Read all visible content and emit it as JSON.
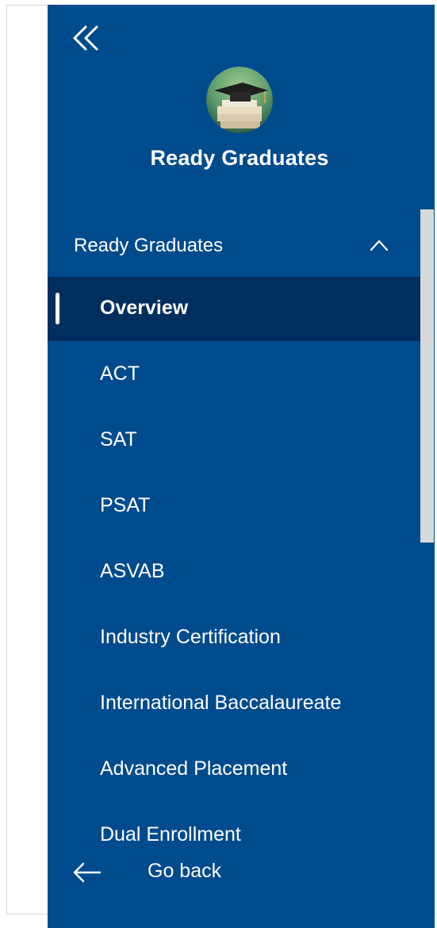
{
  "app": {
    "title": "Ready Graduates"
  },
  "icons": {
    "collapse": "double-chevron-left-icon",
    "section_toggle": "chevron-up-icon",
    "back": "arrow-left-icon"
  },
  "colors": {
    "sidebar_bg": "#004b8d",
    "active_item_bg": "#002e5e",
    "text": "#ffffff",
    "scrollbar": "#d9d9d9"
  },
  "section": {
    "label": "Ready Graduates",
    "expanded": true
  },
  "nav": {
    "items": [
      {
        "label": "Overview",
        "active": true
      },
      {
        "label": "ACT",
        "active": false
      },
      {
        "label": "SAT",
        "active": false
      },
      {
        "label": "PSAT",
        "active": false
      },
      {
        "label": "ASVAB",
        "active": false
      },
      {
        "label": "Industry Certification",
        "active": false
      },
      {
        "label": "International Baccalaureate",
        "active": false
      },
      {
        "label": "Advanced Placement",
        "active": false
      },
      {
        "label": "Dual Enrollment",
        "active": false
      }
    ]
  },
  "footer": {
    "back_label": "Go back"
  }
}
